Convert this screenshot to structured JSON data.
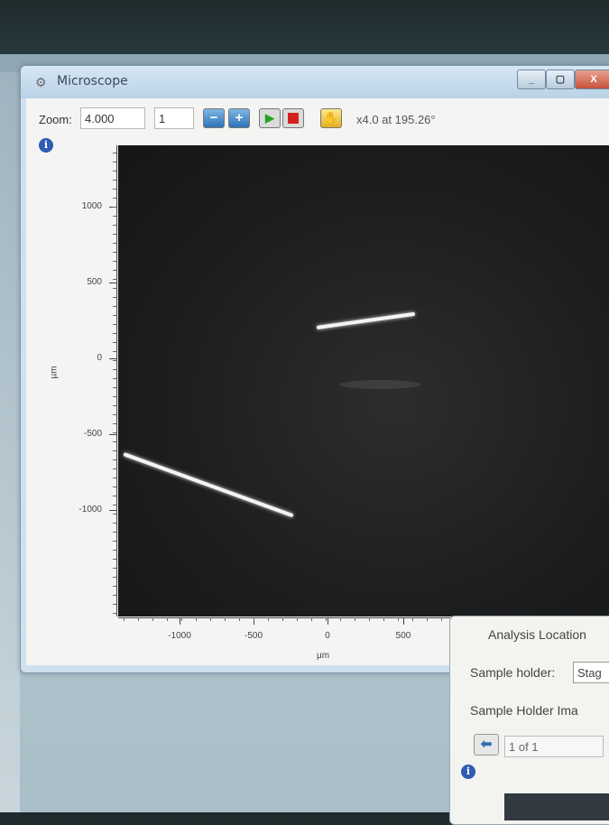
{
  "window": {
    "title": "Microscope",
    "app_icon": "microscope-icon",
    "min_glyph": "_",
    "max_glyph": "▢",
    "close_glyph": "X"
  },
  "toolbar": {
    "zoom_label": "Zoom:",
    "zoom_value": "4.000",
    "step_value": "1",
    "minus_glyph": "−",
    "plus_glyph": "+",
    "play_glyph": "▶",
    "hand_glyph": "✋",
    "status": "x4.0 at 195.26°"
  },
  "plot": {
    "info_glyph": "i",
    "y_unit": "µm",
    "x_unit": "µm",
    "y_ticks": [
      "1000",
      "500",
      "0",
      "-500",
      "-1000"
    ],
    "x_ticks": [
      "-1000",
      "-500",
      "0",
      "500"
    ]
  },
  "analysis_panel": {
    "title": "Analysis Location",
    "sample_holder_label": "Sample holder:",
    "sample_holder_value": "Stag",
    "sample_holder_image_label": "Sample Holder Ima",
    "back_glyph": "⬅",
    "page_value": "1 of 1",
    "info_glyph": "i"
  }
}
